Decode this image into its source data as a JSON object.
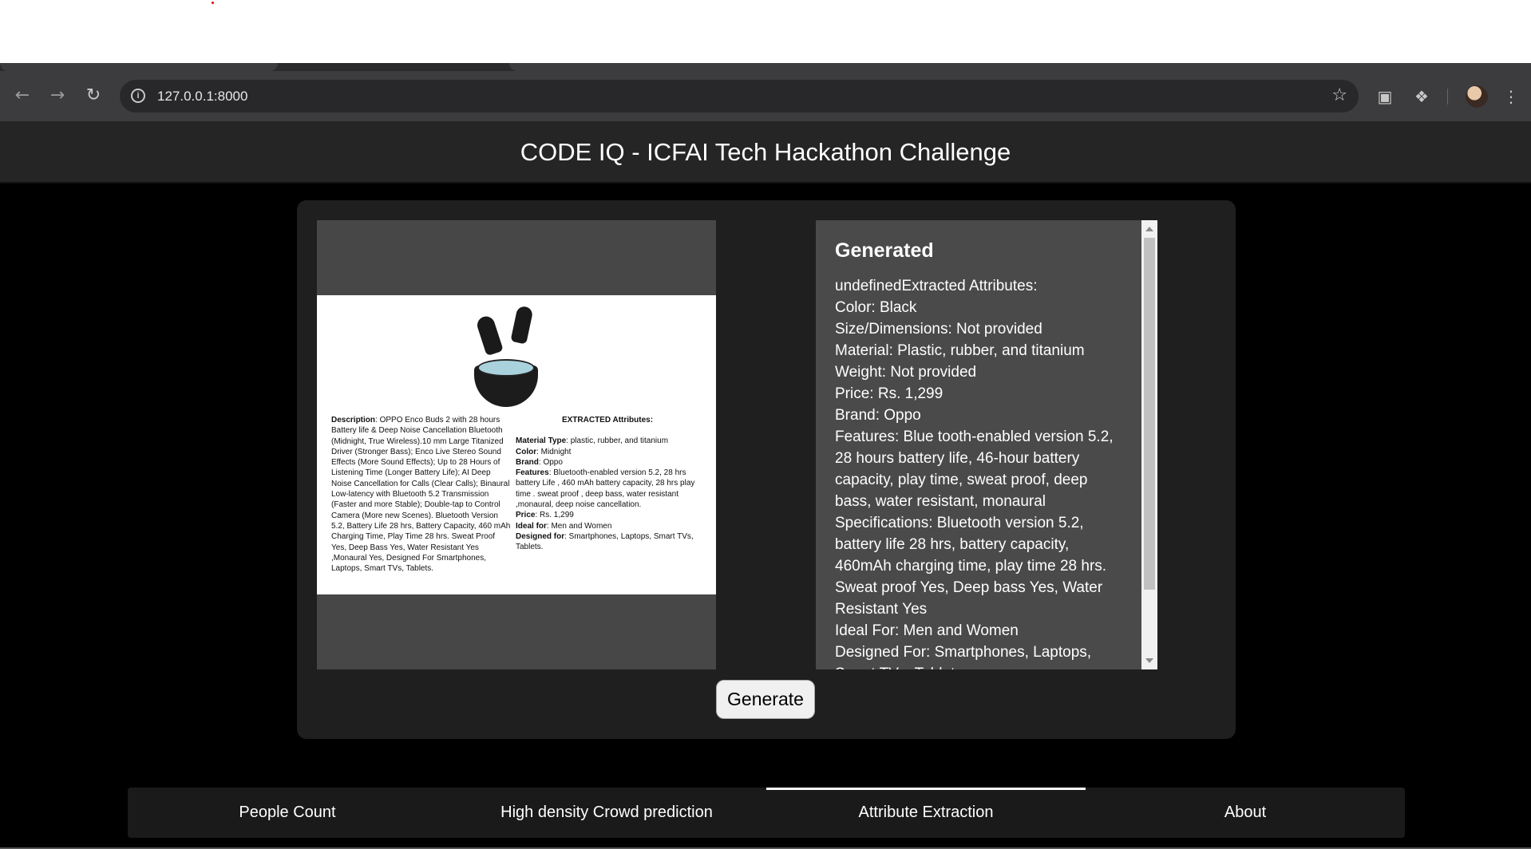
{
  "browser": {
    "url": "127.0.0.1:8000"
  },
  "app": {
    "title": "CODE IQ - ICFAI Tech Hackathon Challenge"
  },
  "product_image": {
    "description_label": "Description",
    "description_text": ": OPPO Enco Buds 2 with 28 hours Battery life & Deep Noise Cancellation Bluetooth  (Midnight, True Wireless).10 mm Large Titanized Driver (Stronger Bass); Enco Live Stereo Sound Effects (More Sound Effects); Up to 28 Hours of Listening Time (Longer Battery Life); AI Deep Noise Cancellation for Calls (Clear Calls); Binaural Low-latency with Bluetooth 5.2 Transmission (Faster and more Stable); Double-tap to Control Camera (More new Scenes). Bluetooth Version 5.2, Battery Life 28 hrs, Battery Capacity, 460 mAh Charging Time, Play Time 28 hrs. Sweat Proof Yes, Deep Bass Yes, Water Resistant Yes ,Monaural Yes, Designed For Smartphones, Laptops, Smart TVs, Tablets.",
    "attributes_title": "EXTRACTED Attributes:",
    "attributes": [
      {
        "label": "Material Type",
        "value": ":  plastic, rubber, and titanium"
      },
      {
        "label": "Color",
        "value": ": Midnight"
      },
      {
        "label": "Brand",
        "value": ": Oppo"
      },
      {
        "label": "Features",
        "value": ": Bluetooth-enabled version 5.2, 28 hrs battery Life ,  460 mAh battery capacity, 28 hrs play time . sweat proof , deep bass, water resistant ,monaural, deep noise cancellation."
      },
      {
        "label": "Price",
        "value": ": Rs. 1,299"
      },
      {
        "label": "Ideal for",
        "value": ": Men and Women"
      },
      {
        "label": "Designed for",
        "value": ": Smartphones, Laptops, Smart TVs, Tablets."
      }
    ]
  },
  "result": {
    "heading": "Generated",
    "text": "undefinedExtracted Attributes:\nColor: Black\nSize/Dimensions: Not provided\nMaterial: Plastic, rubber, and titanium\nWeight: Not provided\nPrice: Rs. 1,299\nBrand: Oppo\nFeatures: Blue tooth-enabled version 5.2, 28 hours battery life, 46-hour battery capacity, play time, sweat proof, deep bass, water resistant, monaural\nSpecifications: Bluetooth version 5.2, battery life 28 hrs, battery capacity, 460mAh charging time, play time 28 hrs. Sweat proof Yes, Deep bass Yes, Water Resistant Yes\nIdeal For: Men and Women\nDesigned For: Smartphones, Laptops, Smart TVs, Tablets"
  },
  "generate_button": {
    "label": "Generate"
  },
  "bottom_nav": {
    "items": [
      {
        "label": "People Count"
      },
      {
        "label": "High density Crowd prediction"
      },
      {
        "label": "Attribute Extraction",
        "active": true
      },
      {
        "label": "About"
      }
    ]
  },
  "icons": {
    "back": "back-arrow-icon",
    "forward": "forward-arrow-icon",
    "reload": "reload-icon",
    "site_info": "info-icon",
    "bookmark": "star-icon",
    "tab_search": "tab-search-icon",
    "extensions": "puzzle-icon",
    "menu": "kebab-menu-icon"
  },
  "colors": {
    "page_bg": "#000000",
    "card_bg": "#1f1f1f",
    "result_bg": "#4a4a4a",
    "header_bg": "#252525"
  }
}
